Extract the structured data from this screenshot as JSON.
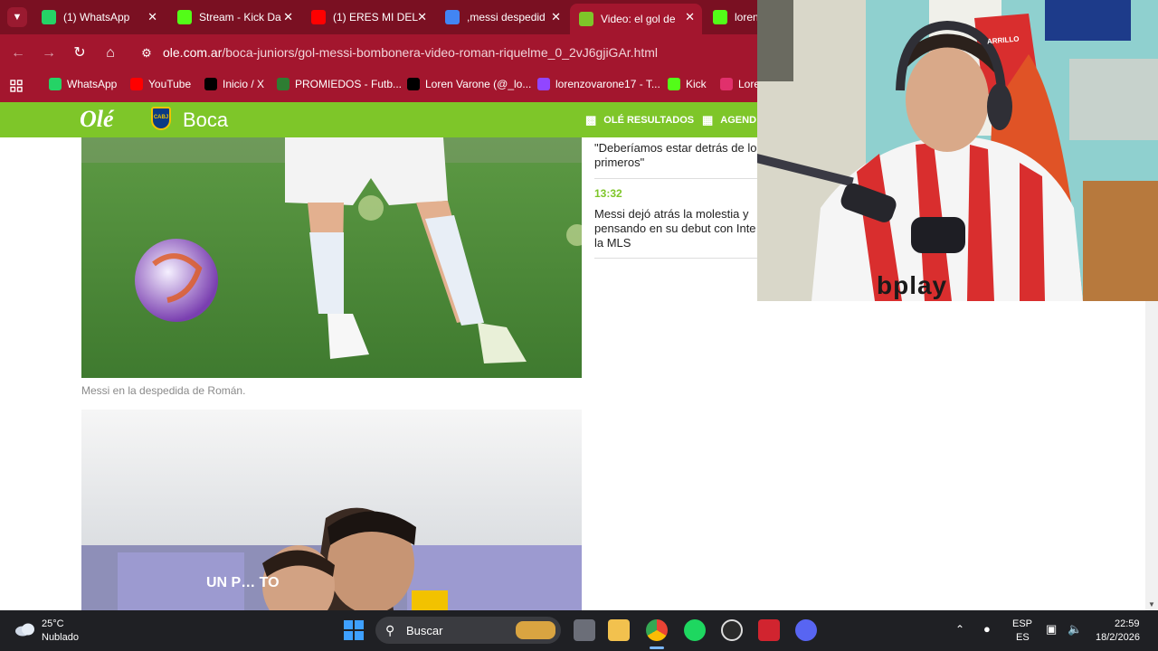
{
  "browser": {
    "tabs": [
      {
        "title": "(1) WhatsApp",
        "icon": "whatsapp-icon",
        "color": "#25D366",
        "active": false
      },
      {
        "title": "Stream - Kick Da",
        "icon": "kick-icon",
        "color": "#53FC18",
        "active": false
      },
      {
        "title": "(1) ERES MI DEL",
        "icon": "youtube-icon",
        "color": "#FF0000",
        "active": false
      },
      {
        "title": ",messi despedid",
        "icon": "google-icon",
        "color": "#4285F4",
        "active": false
      },
      {
        "title": "Video: el gol de",
        "icon": "ole-icon",
        "color": "#7EC629",
        "active": true
      },
      {
        "title": "loren",
        "icon": "kick-icon",
        "color": "#53FC18",
        "active": false
      }
    ],
    "url": {
      "host": "ole.com.ar",
      "path": "/boca-juniors/gol-messi-bombonera-video-roman-riquelme_0_2vJ6gjiGAr.html"
    },
    "bookmarks": [
      {
        "label": "WhatsApp",
        "icon": "whatsapp-icon",
        "color": "#25D366"
      },
      {
        "label": "YouTube",
        "icon": "youtube-icon",
        "color": "#FF0000"
      },
      {
        "label": "Inicio / X",
        "icon": "x-icon",
        "color": "#000000"
      },
      {
        "label": "PROMIEDOS - Futb...",
        "icon": "promiedos-icon",
        "color": "#2E7D32"
      },
      {
        "label": "Loren Varone (@_lo...",
        "icon": "tiktok-icon",
        "color": "#000000"
      },
      {
        "label": "lorenzovarone17 - T...",
        "icon": "twitch-icon",
        "color": "#9146FF"
      },
      {
        "label": "Kick",
        "icon": "kick-icon",
        "color": "#53FC18"
      },
      {
        "label": "Lore",
        "icon": "instagram-icon",
        "color": "#E1306C"
      }
    ]
  },
  "site": {
    "logo": "Olé",
    "shield_text": "CABJ",
    "section": "Boca",
    "nav": [
      {
        "label": "OLÉ RESULTADOS",
        "icon": "chart-icon"
      },
      {
        "label": "AGEND",
        "icon": "calendar-icon"
      }
    ]
  },
  "article": {
    "caption": "Messi en la despedida de Román.",
    "banner_text": "UN P… TO"
  },
  "feed": {
    "item1_line1": "\"Deberíamos estar detrás de lo",
    "item1_line2": "primeros\"",
    "item2_time": "13:32",
    "item2_line1": "Messi dejó atrás la molestia y",
    "item2_line2": "pensando en su debut con Inte",
    "item2_line3": "la MLS"
  },
  "webcam": {
    "shirt_text": "bplay",
    "jersey_on_wall": "ARRILLO"
  },
  "taskbar": {
    "weather_temp": "25°C",
    "weather_desc": "Nublado",
    "search_placeholder": "Buscar",
    "lang_top": "ESP",
    "lang_bottom": "ES",
    "time": "22:59",
    "date": "18/2/2026"
  }
}
